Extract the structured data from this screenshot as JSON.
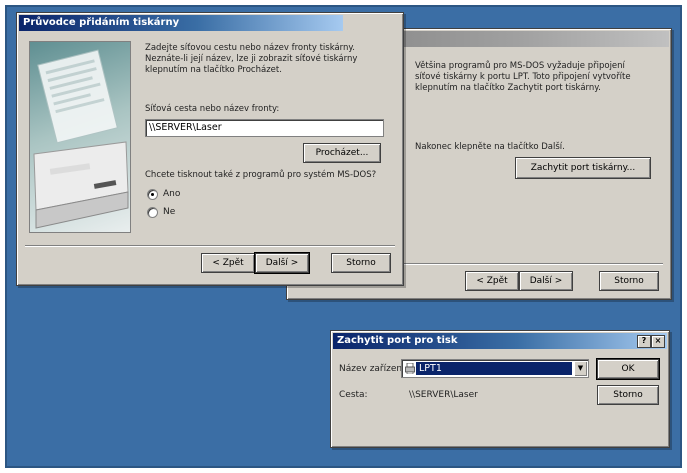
{
  "wizard": {
    "title": "Průvodce přidáním tiskárny",
    "intro": "Zadejte síťovou cestu nebo název fronty tiskárny.\nNeznáte-li její název, lze ji zobrazit síťové tiskárny\nklepnutím na tlačítko Procházet.",
    "path_label": "Síťová cesta nebo název fronty:",
    "path_value": "\\\\SERVER\\Laser",
    "browse_label": "Procházet...",
    "msdos_question": "Chcete tisknout také z programů pro systém MS-DOS?",
    "option_yes": "Ano",
    "option_no": "Ne",
    "selected_option": "Ano",
    "back_label": "< Zpět",
    "next_label": "Další >",
    "cancel_label": "Storno"
  },
  "background_wizard": {
    "title": "",
    "text1": "Většina programů pro MS-DOS vyžaduje připojení\nsíťové tiskárny k portu LPT. Toto připojení vytvoříte\nklepnutím na tlačítko Zachytit port tiskárny.",
    "text2": "Nakonec klepněte na tlačítko Další.",
    "capture_label": "Zachytit port tiskárny...",
    "back_label": "< Zpět",
    "next_label": "Další >",
    "cancel_label": "Storno"
  },
  "capture_dialog": {
    "title": "Zachytit port pro tisk",
    "help_glyph": "?",
    "close_glyph": "×",
    "device_label": "Název zařízení:",
    "device_value": "LPT1",
    "path_label": "Cesta:",
    "path_value": "\\\\SERVER\\Laser",
    "ok_label": "OK",
    "cancel_label": "Storno"
  },
  "colors": {
    "desktop": "#3b6ea5",
    "window_face": "#d4d0c8",
    "title_active": "#0a246a",
    "selection": "#0a246a"
  }
}
